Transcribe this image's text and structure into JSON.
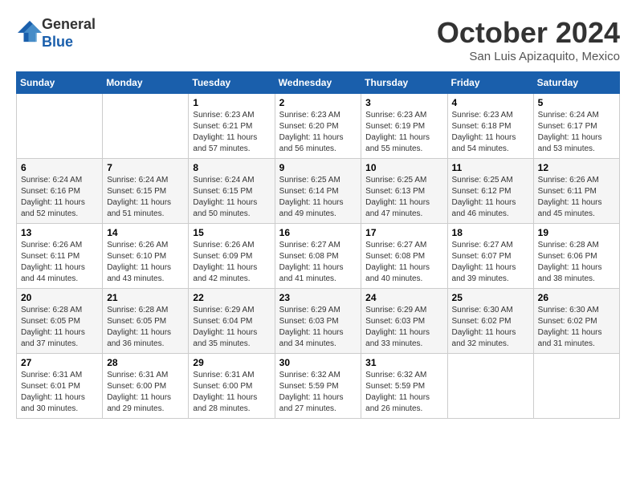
{
  "header": {
    "logo": {
      "line1": "General",
      "line2": "Blue"
    },
    "title": "October 2024",
    "location": "San Luis Apizaquito, Mexico"
  },
  "days_of_week": [
    "Sunday",
    "Monday",
    "Tuesday",
    "Wednesday",
    "Thursday",
    "Friday",
    "Saturday"
  ],
  "weeks": [
    [
      {
        "day": "",
        "sunrise": "",
        "sunset": "",
        "daylight": ""
      },
      {
        "day": "",
        "sunrise": "",
        "sunset": "",
        "daylight": ""
      },
      {
        "day": "1",
        "sunrise": "Sunrise: 6:23 AM",
        "sunset": "Sunset: 6:21 PM",
        "daylight": "Daylight: 11 hours and 57 minutes."
      },
      {
        "day": "2",
        "sunrise": "Sunrise: 6:23 AM",
        "sunset": "Sunset: 6:20 PM",
        "daylight": "Daylight: 11 hours and 56 minutes."
      },
      {
        "day": "3",
        "sunrise": "Sunrise: 6:23 AM",
        "sunset": "Sunset: 6:19 PM",
        "daylight": "Daylight: 11 hours and 55 minutes."
      },
      {
        "day": "4",
        "sunrise": "Sunrise: 6:23 AM",
        "sunset": "Sunset: 6:18 PM",
        "daylight": "Daylight: 11 hours and 54 minutes."
      },
      {
        "day": "5",
        "sunrise": "Sunrise: 6:24 AM",
        "sunset": "Sunset: 6:17 PM",
        "daylight": "Daylight: 11 hours and 53 minutes."
      }
    ],
    [
      {
        "day": "6",
        "sunrise": "Sunrise: 6:24 AM",
        "sunset": "Sunset: 6:16 PM",
        "daylight": "Daylight: 11 hours and 52 minutes."
      },
      {
        "day": "7",
        "sunrise": "Sunrise: 6:24 AM",
        "sunset": "Sunset: 6:15 PM",
        "daylight": "Daylight: 11 hours and 51 minutes."
      },
      {
        "day": "8",
        "sunrise": "Sunrise: 6:24 AM",
        "sunset": "Sunset: 6:15 PM",
        "daylight": "Daylight: 11 hours and 50 minutes."
      },
      {
        "day": "9",
        "sunrise": "Sunrise: 6:25 AM",
        "sunset": "Sunset: 6:14 PM",
        "daylight": "Daylight: 11 hours and 49 minutes."
      },
      {
        "day": "10",
        "sunrise": "Sunrise: 6:25 AM",
        "sunset": "Sunset: 6:13 PM",
        "daylight": "Daylight: 11 hours and 47 minutes."
      },
      {
        "day": "11",
        "sunrise": "Sunrise: 6:25 AM",
        "sunset": "Sunset: 6:12 PM",
        "daylight": "Daylight: 11 hours and 46 minutes."
      },
      {
        "day": "12",
        "sunrise": "Sunrise: 6:26 AM",
        "sunset": "Sunset: 6:11 PM",
        "daylight": "Daylight: 11 hours and 45 minutes."
      }
    ],
    [
      {
        "day": "13",
        "sunrise": "Sunrise: 6:26 AM",
        "sunset": "Sunset: 6:11 PM",
        "daylight": "Daylight: 11 hours and 44 minutes."
      },
      {
        "day": "14",
        "sunrise": "Sunrise: 6:26 AM",
        "sunset": "Sunset: 6:10 PM",
        "daylight": "Daylight: 11 hours and 43 minutes."
      },
      {
        "day": "15",
        "sunrise": "Sunrise: 6:26 AM",
        "sunset": "Sunset: 6:09 PM",
        "daylight": "Daylight: 11 hours and 42 minutes."
      },
      {
        "day": "16",
        "sunrise": "Sunrise: 6:27 AM",
        "sunset": "Sunset: 6:08 PM",
        "daylight": "Daylight: 11 hours and 41 minutes."
      },
      {
        "day": "17",
        "sunrise": "Sunrise: 6:27 AM",
        "sunset": "Sunset: 6:08 PM",
        "daylight": "Daylight: 11 hours and 40 minutes."
      },
      {
        "day": "18",
        "sunrise": "Sunrise: 6:27 AM",
        "sunset": "Sunset: 6:07 PM",
        "daylight": "Daylight: 11 hours and 39 minutes."
      },
      {
        "day": "19",
        "sunrise": "Sunrise: 6:28 AM",
        "sunset": "Sunset: 6:06 PM",
        "daylight": "Daylight: 11 hours and 38 minutes."
      }
    ],
    [
      {
        "day": "20",
        "sunrise": "Sunrise: 6:28 AM",
        "sunset": "Sunset: 6:05 PM",
        "daylight": "Daylight: 11 hours and 37 minutes."
      },
      {
        "day": "21",
        "sunrise": "Sunrise: 6:28 AM",
        "sunset": "Sunset: 6:05 PM",
        "daylight": "Daylight: 11 hours and 36 minutes."
      },
      {
        "day": "22",
        "sunrise": "Sunrise: 6:29 AM",
        "sunset": "Sunset: 6:04 PM",
        "daylight": "Daylight: 11 hours and 35 minutes."
      },
      {
        "day": "23",
        "sunrise": "Sunrise: 6:29 AM",
        "sunset": "Sunset: 6:03 PM",
        "daylight": "Daylight: 11 hours and 34 minutes."
      },
      {
        "day": "24",
        "sunrise": "Sunrise: 6:29 AM",
        "sunset": "Sunset: 6:03 PM",
        "daylight": "Daylight: 11 hours and 33 minutes."
      },
      {
        "day": "25",
        "sunrise": "Sunrise: 6:30 AM",
        "sunset": "Sunset: 6:02 PM",
        "daylight": "Daylight: 11 hours and 32 minutes."
      },
      {
        "day": "26",
        "sunrise": "Sunrise: 6:30 AM",
        "sunset": "Sunset: 6:02 PM",
        "daylight": "Daylight: 11 hours and 31 minutes."
      }
    ],
    [
      {
        "day": "27",
        "sunrise": "Sunrise: 6:31 AM",
        "sunset": "Sunset: 6:01 PM",
        "daylight": "Daylight: 11 hours and 30 minutes."
      },
      {
        "day": "28",
        "sunrise": "Sunrise: 6:31 AM",
        "sunset": "Sunset: 6:00 PM",
        "daylight": "Daylight: 11 hours and 29 minutes."
      },
      {
        "day": "29",
        "sunrise": "Sunrise: 6:31 AM",
        "sunset": "Sunset: 6:00 PM",
        "daylight": "Daylight: 11 hours and 28 minutes."
      },
      {
        "day": "30",
        "sunrise": "Sunrise: 6:32 AM",
        "sunset": "Sunset: 5:59 PM",
        "daylight": "Daylight: 11 hours and 27 minutes."
      },
      {
        "day": "31",
        "sunrise": "Sunrise: 6:32 AM",
        "sunset": "Sunset: 5:59 PM",
        "daylight": "Daylight: 11 hours and 26 minutes."
      },
      {
        "day": "",
        "sunrise": "",
        "sunset": "",
        "daylight": ""
      },
      {
        "day": "",
        "sunrise": "",
        "sunset": "",
        "daylight": ""
      }
    ]
  ]
}
